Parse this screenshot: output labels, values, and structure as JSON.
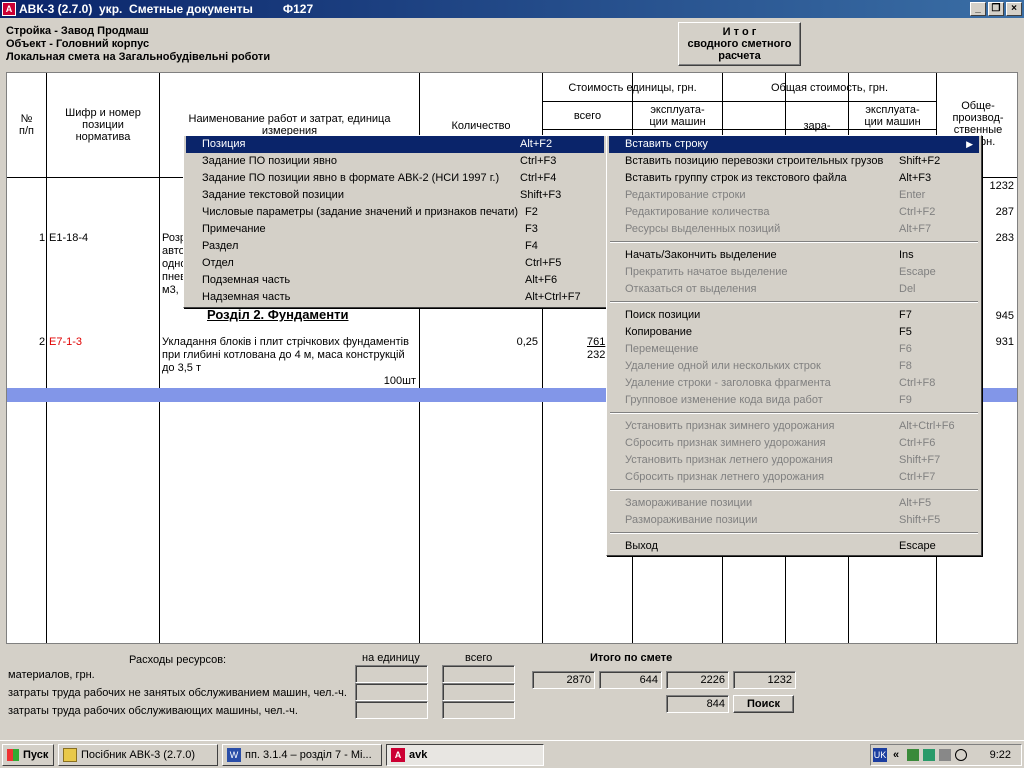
{
  "window": {
    "title": "АВК-3 (2.7.0)  укр.  Сметные документы         Ф127",
    "app_icon": "avk-icon"
  },
  "header": {
    "lines": [
      "Стройка - Завод Продмаш",
      "Объект - Головний корпус",
      "Локальная смета на Загальнобудівельні роботи"
    ],
    "itog_button": [
      "И т о г",
      "сводного сметного",
      "расчета"
    ]
  },
  "table": {
    "headers": {
      "num": [
        "№",
        "п/п"
      ],
      "code": [
        "Шифр и номер",
        "позиции",
        "норматива"
      ],
      "name": [
        "Наименование работ и затрат, единица",
        "измерения"
      ],
      "qty": "Количество",
      "unit_cost": "Стоимость единицы, грн.",
      "unit_total": "всего",
      "unit_machines": [
        "эксплуата-",
        "ции машин"
      ],
      "total_cost": "Общая стоимость, грн.",
      "total_wages": "зара-",
      "total_machines": [
        "эксплуата-",
        "ции машин"
      ],
      "prod": [
        "Обще-",
        "производ-",
        "ственные",
        "..., грн."
      ]
    },
    "right_values": [
      "1232",
      "287",
      "283",
      "945",
      "931"
    ],
    "rows": [
      {
        "num": "1",
        "code": "Е1-18-4",
        "name_lines": [
          "Розр",
          "авто",
          "одно",
          "пнев",
          "м3,"
        ]
      },
      {
        "section": "Розділ 2. Фундаменти"
      },
      {
        "num": "2",
        "code": "Е7-1-3",
        "name_lines": [
          "Укладання блоків і плит стрічкових фундаментів",
          "при глибині котлована до 4 м, маса конструкцій",
          "до 3,5 т"
        ],
        "unit": "100шт",
        "qty": "0,25",
        "unit_total_1": "761",
        "unit_total_2": "232"
      }
    ]
  },
  "left_menu": {
    "items": [
      {
        "label": "Позиция",
        "key": "Alt+F2",
        "state": "selected"
      },
      {
        "label": "Задание ПО позиции явно",
        "key": "Ctrl+F3"
      },
      {
        "label": "Задание ПО позиции явно в формате АВК-2 (НСИ 1997 г.)",
        "key": "Ctrl+F4"
      },
      {
        "label": "Задание текстовой позиции",
        "key": "Shift+F3"
      },
      {
        "label": "Числовые параметры (задание значений и признаков печати)",
        "key": "F2"
      },
      {
        "label": "Примечание",
        "key": "F3"
      },
      {
        "label": "Раздел",
        "key": "F4"
      },
      {
        "label": "Отдел",
        "key": "Ctrl+F5"
      },
      {
        "label": "Подземная часть",
        "key": "Alt+F6"
      },
      {
        "label": "Надземная часть",
        "key": "Alt+Ctrl+F7"
      }
    ]
  },
  "right_menu": {
    "groups": [
      [
        {
          "label": "Вставить строку",
          "key": "",
          "state": "selected",
          "submenu": true
        },
        {
          "label": "Вставить позицию перевозки строительных грузов",
          "key": "Shift+F2"
        },
        {
          "label": "Вставить группу строк из текстового файла",
          "key": "Alt+F3"
        },
        {
          "label": "Редактирование строки",
          "key": "Enter",
          "state": "disabled"
        },
        {
          "label": "Редактирование количества",
          "key": "Ctrl+F2",
          "state": "disabled"
        },
        {
          "label": "Ресурсы выделенных позиций",
          "key": "Alt+F7",
          "state": "disabled"
        }
      ],
      [
        {
          "label": "Начать/Закончить выделение",
          "key": "Ins"
        },
        {
          "label": "Прекратить начатое выделение",
          "key": "Escape",
          "state": "disabled"
        },
        {
          "label": "Отказаться от выделения",
          "key": "Del",
          "state": "disabled"
        }
      ],
      [
        {
          "label": "Поиск позиции",
          "key": "F7"
        },
        {
          "label": "Копирование",
          "key": "F5"
        },
        {
          "label": "Перемещение",
          "key": "F6",
          "state": "disabled"
        },
        {
          "label": "Удаление одной или нескольких строк",
          "key": "F8",
          "state": "disabled"
        },
        {
          "label": "Удаление строки - заголовка фрагмента",
          "key": "Ctrl+F8",
          "state": "disabled"
        },
        {
          "label": "Групповое изменение кода вида работ",
          "key": "F9",
          "state": "disabled"
        }
      ],
      [
        {
          "label": "Установить признак зимнего удорожания",
          "key": "Alt+Ctrl+F6",
          "state": "disabled"
        },
        {
          "label": "Сбросить признак зимнего удорожания",
          "key": "Ctrl+F6",
          "state": "disabled"
        },
        {
          "label": "Установить признак летнего удорожания",
          "key": "Shift+F7",
          "state": "disabled"
        },
        {
          "label": "Сбросить признак летнего удорожания",
          "key": "Ctrl+F7",
          "state": "disabled"
        }
      ],
      [
        {
          "label": "Замораживание позиции",
          "key": "Alt+F5",
          "state": "disabled"
        },
        {
          "label": "Размораживание позиции",
          "key": "Shift+F5",
          "state": "disabled"
        }
      ],
      [
        {
          "label": "Выход",
          "key": "Escape"
        }
      ]
    ]
  },
  "bottom": {
    "resources_title": "Расходы ресурсов:",
    "per_unit": "на единицу",
    "total": "всего",
    "itog_title": "Итого   по   смете",
    "rows": [
      "материалов, грн.",
      "затраты труда рабочих не занятых обслуживанием машин, чел.-ч.",
      "затраты труда рабочих обслуживающих машины, чел.-ч."
    ],
    "itog_values": [
      "2870",
      "644",
      "2226",
      "1232"
    ],
    "itog_value_2": "844",
    "search_button": "Поиск"
  },
  "taskbar": {
    "start": "Пуск",
    "tasks": [
      {
        "label": "Посібник АВК-3 (2.7.0)",
        "icon": "folder-icon"
      },
      {
        "label": "пп. 3.1.4 – розділ 7 - Mi...",
        "icon": "word-icon"
      },
      {
        "label": "avk",
        "icon": "avk-icon",
        "active": true
      }
    ],
    "lang": "UK",
    "clock": "9:22"
  }
}
